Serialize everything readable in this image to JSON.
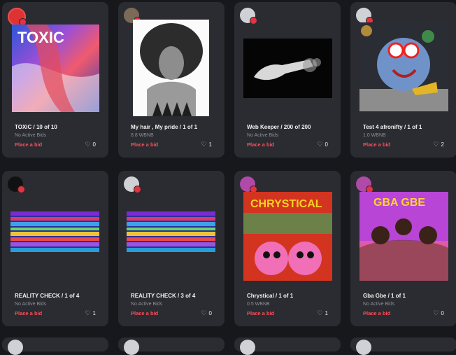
{
  "cards": [
    {
      "title": "TOXIC / 10 of 10",
      "sub": "No Active Bids",
      "bid": "Place a bid",
      "likes": "0",
      "art_text": "TOXIC"
    },
    {
      "title": "My hair , My pride / 1 of 1",
      "sub": "8.8 WBNB",
      "bid": "Place a bid",
      "likes": "1"
    },
    {
      "title": "Web Keeper / 200 of 200",
      "sub": "No Active Bids",
      "bid": "Place a bid",
      "likes": "0"
    },
    {
      "title": "Test 4 afronifty / 1 of 1",
      "sub": "1.0 WBNB",
      "bid": "Place a bid",
      "likes": "2"
    },
    {
      "title": "REALITY CHECK / 1 of 4",
      "sub": "No Active Bids",
      "bid": "Place a bid",
      "likes": "1"
    },
    {
      "title": "REALITY CHECK / 3 of 4",
      "sub": "No Active Bids",
      "bid": "Place a bid",
      "likes": "0"
    },
    {
      "title": "Chrystical / 1 of 1",
      "sub": "0.5 WBNB",
      "bid": "Place a bid",
      "likes": "1",
      "art_text": "CHRYSTICAL"
    },
    {
      "title": "Gba Gbe / 1 of 1",
      "sub": "No Active Bids",
      "bid": "Place a bid",
      "likes": "0",
      "art_text": "GBA GBE"
    }
  ],
  "colors": {
    "accent": "#ff4d59",
    "card": "#2a2c31",
    "page": "#17181b"
  },
  "icons": {
    "heart": "heart-icon",
    "verified": "verified-check-icon"
  }
}
